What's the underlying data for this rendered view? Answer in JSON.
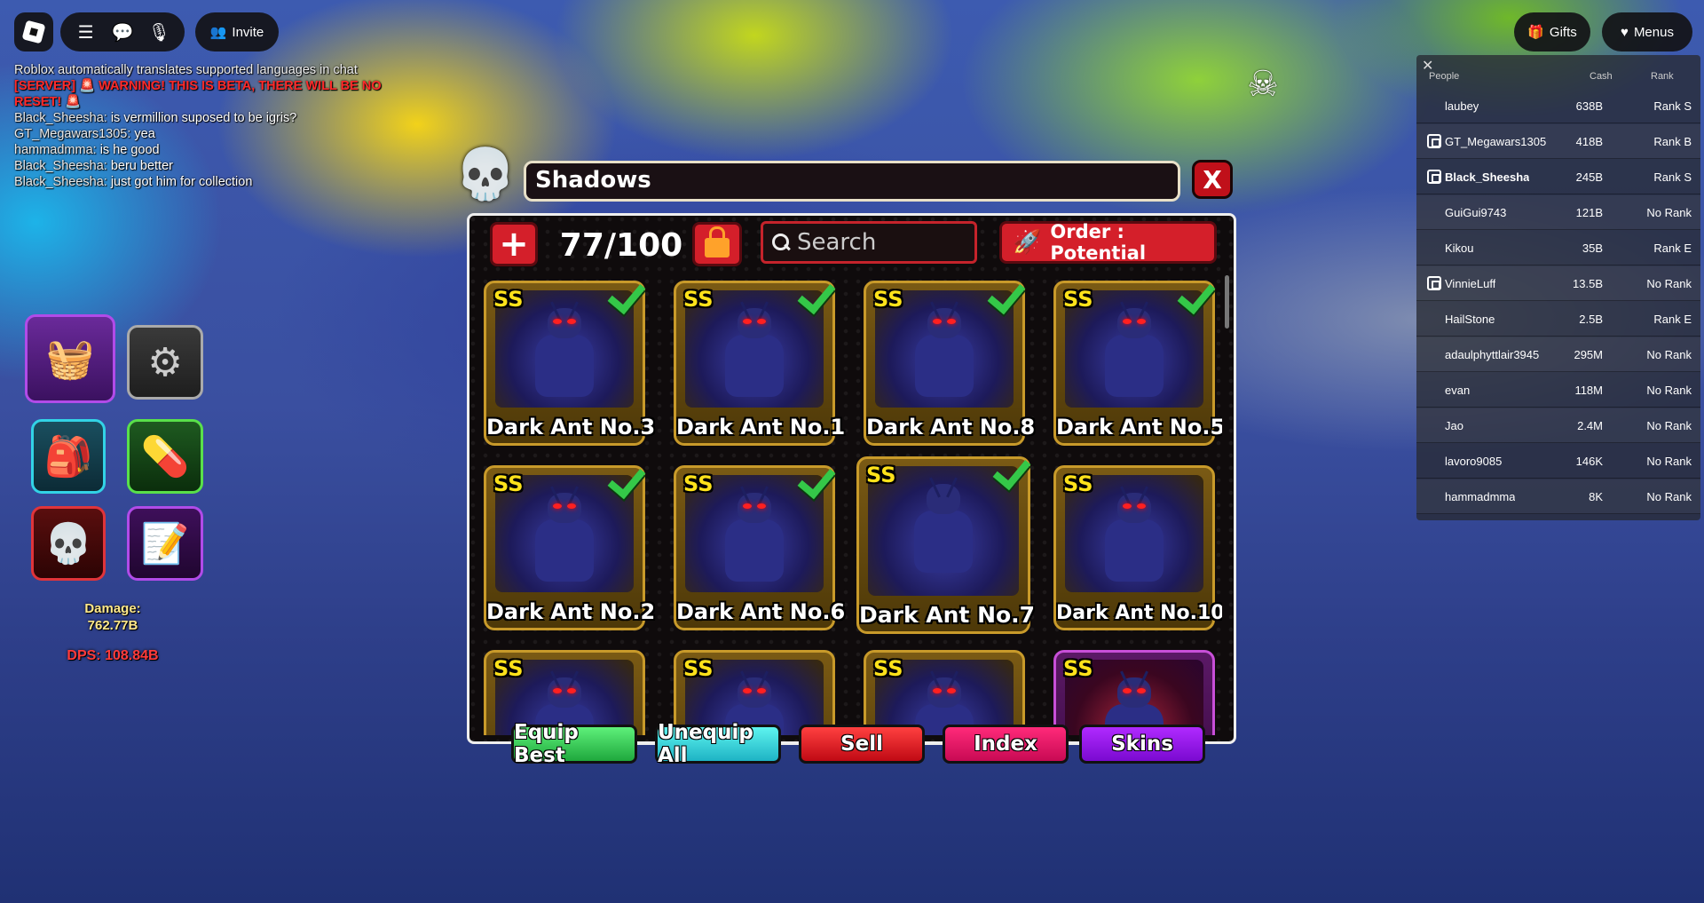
{
  "topbar": {
    "invite_label": "Invite",
    "gifts_label": "Gifts",
    "menus_label": "Menus"
  },
  "chat": {
    "system_line": "Roblox automatically translates supported languages in chat",
    "server_warning": "[SERVER] 🚨 WARNING! THIS IS BETA, THERE WILL BE NO RESET! 🚨",
    "messages": [
      {
        "name": "Black_Sheesha:",
        "text": "is vermillion suposed to be igris?"
      },
      {
        "name": "GT_Megawars1305:",
        "text": "yea"
      },
      {
        "name": "hammadmma:",
        "text": "is he good"
      },
      {
        "name": "Black_Sheesha:",
        "text": "beru better"
      },
      {
        "name": "Black_Sheesha:",
        "text": "just got him for collection"
      }
    ]
  },
  "stats": {
    "damage_label": "Damage:",
    "damage_value": "762.77B",
    "dps": "DPS: 108.84B"
  },
  "leaderboard": {
    "close": "✕",
    "headers": {
      "people": "People",
      "cash": "Cash",
      "rank": "Rank"
    },
    "rows": [
      {
        "name": "laubey",
        "cash": "638B",
        "rank": "Rank S"
      },
      {
        "name": "GT_Megawars1305",
        "cash": "418B",
        "rank": "Rank B"
      },
      {
        "name": "Black_Sheesha",
        "cash": "245B",
        "rank": "Rank S"
      },
      {
        "name": "GuiGui9743",
        "cash": "121B",
        "rank": "No Rank"
      },
      {
        "name": "Kikou",
        "cash": "35B",
        "rank": "Rank E"
      },
      {
        "name": "VinnieLuff",
        "cash": "13.5B",
        "rank": "No Rank"
      },
      {
        "name": "HailStone",
        "cash": "2.5B",
        "rank": "Rank E"
      },
      {
        "name": "adaulphyttlair3945",
        "cash": "295M",
        "rank": "No Rank"
      },
      {
        "name": "evan",
        "cash": "118M",
        "rank": "No Rank"
      },
      {
        "name": "Jao",
        "cash": "2.4M",
        "rank": "No Rank"
      },
      {
        "name": "lavoro9085",
        "cash": "146K",
        "rank": "No Rank"
      },
      {
        "name": "hammadmma",
        "cash": "8K",
        "rank": "No Rank"
      }
    ]
  },
  "shadows": {
    "title": "Shadows",
    "close": "X",
    "add": "+",
    "count": "77/100",
    "search_placeholder": "Search",
    "order_label": "Order : Potential",
    "cards": [
      {
        "rank": "SS",
        "name": "Dark Ant No.3",
        "equipped": true
      },
      {
        "rank": "SS",
        "name": "Dark Ant No.1",
        "equipped": true
      },
      {
        "rank": "SS",
        "name": "Dark Ant No.8",
        "equipped": true
      },
      {
        "rank": "SS",
        "name": "Dark Ant No.5",
        "equipped": true
      },
      {
        "rank": "SS",
        "name": "Dark Ant No.2",
        "equipped": true
      },
      {
        "rank": "SS",
        "name": "Dark Ant No.6",
        "equipped": true
      },
      {
        "rank": "SS",
        "name": "Dark Ant No.7",
        "equipped": true
      },
      {
        "rank": "SS",
        "name": "Dark Ant No.10",
        "equipped": false
      },
      {
        "rank": "SS",
        "name": "",
        "equipped": false
      },
      {
        "rank": "SS",
        "name": "",
        "equipped": false
      },
      {
        "rank": "SS",
        "name": "",
        "equipped": false
      },
      {
        "rank": "SS",
        "name": "",
        "equipped": false
      }
    ]
  },
  "actions": {
    "equip_best": "Equip Best",
    "unequip_all": "Unequip All",
    "sell": "Sell",
    "index": "Index",
    "skins": "Skins"
  }
}
